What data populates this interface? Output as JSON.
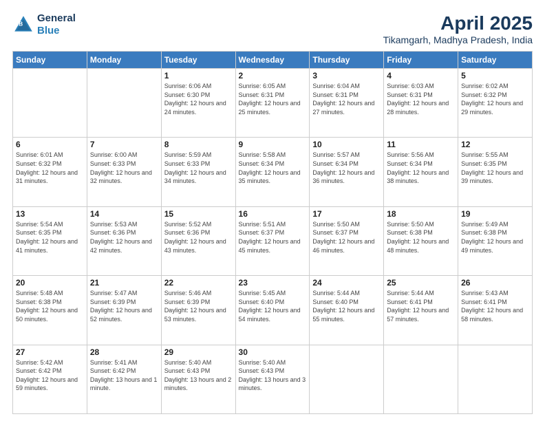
{
  "header": {
    "logo_line1": "General",
    "logo_line2": "Blue",
    "title": "April 2025",
    "subtitle": "Tikamgarh, Madhya Pradesh, India"
  },
  "days_of_week": [
    "Sunday",
    "Monday",
    "Tuesday",
    "Wednesday",
    "Thursday",
    "Friday",
    "Saturday"
  ],
  "weeks": [
    [
      {
        "day": "",
        "sunrise": "",
        "sunset": "",
        "daylight": ""
      },
      {
        "day": "",
        "sunrise": "",
        "sunset": "",
        "daylight": ""
      },
      {
        "day": "1",
        "sunrise": "Sunrise: 6:06 AM",
        "sunset": "Sunset: 6:30 PM",
        "daylight": "Daylight: 12 hours and 24 minutes."
      },
      {
        "day": "2",
        "sunrise": "Sunrise: 6:05 AM",
        "sunset": "Sunset: 6:31 PM",
        "daylight": "Daylight: 12 hours and 25 minutes."
      },
      {
        "day": "3",
        "sunrise": "Sunrise: 6:04 AM",
        "sunset": "Sunset: 6:31 PM",
        "daylight": "Daylight: 12 hours and 27 minutes."
      },
      {
        "day": "4",
        "sunrise": "Sunrise: 6:03 AM",
        "sunset": "Sunset: 6:31 PM",
        "daylight": "Daylight: 12 hours and 28 minutes."
      },
      {
        "day": "5",
        "sunrise": "Sunrise: 6:02 AM",
        "sunset": "Sunset: 6:32 PM",
        "daylight": "Daylight: 12 hours and 29 minutes."
      }
    ],
    [
      {
        "day": "6",
        "sunrise": "Sunrise: 6:01 AM",
        "sunset": "Sunset: 6:32 PM",
        "daylight": "Daylight: 12 hours and 31 minutes."
      },
      {
        "day": "7",
        "sunrise": "Sunrise: 6:00 AM",
        "sunset": "Sunset: 6:33 PM",
        "daylight": "Daylight: 12 hours and 32 minutes."
      },
      {
        "day": "8",
        "sunrise": "Sunrise: 5:59 AM",
        "sunset": "Sunset: 6:33 PM",
        "daylight": "Daylight: 12 hours and 34 minutes."
      },
      {
        "day": "9",
        "sunrise": "Sunrise: 5:58 AM",
        "sunset": "Sunset: 6:34 PM",
        "daylight": "Daylight: 12 hours and 35 minutes."
      },
      {
        "day": "10",
        "sunrise": "Sunrise: 5:57 AM",
        "sunset": "Sunset: 6:34 PM",
        "daylight": "Daylight: 12 hours and 36 minutes."
      },
      {
        "day": "11",
        "sunrise": "Sunrise: 5:56 AM",
        "sunset": "Sunset: 6:34 PM",
        "daylight": "Daylight: 12 hours and 38 minutes."
      },
      {
        "day": "12",
        "sunrise": "Sunrise: 5:55 AM",
        "sunset": "Sunset: 6:35 PM",
        "daylight": "Daylight: 12 hours and 39 minutes."
      }
    ],
    [
      {
        "day": "13",
        "sunrise": "Sunrise: 5:54 AM",
        "sunset": "Sunset: 6:35 PM",
        "daylight": "Daylight: 12 hours and 41 minutes."
      },
      {
        "day": "14",
        "sunrise": "Sunrise: 5:53 AM",
        "sunset": "Sunset: 6:36 PM",
        "daylight": "Daylight: 12 hours and 42 minutes."
      },
      {
        "day": "15",
        "sunrise": "Sunrise: 5:52 AM",
        "sunset": "Sunset: 6:36 PM",
        "daylight": "Daylight: 12 hours and 43 minutes."
      },
      {
        "day": "16",
        "sunrise": "Sunrise: 5:51 AM",
        "sunset": "Sunset: 6:37 PM",
        "daylight": "Daylight: 12 hours and 45 minutes."
      },
      {
        "day": "17",
        "sunrise": "Sunrise: 5:50 AM",
        "sunset": "Sunset: 6:37 PM",
        "daylight": "Daylight: 12 hours and 46 minutes."
      },
      {
        "day": "18",
        "sunrise": "Sunrise: 5:50 AM",
        "sunset": "Sunset: 6:38 PM",
        "daylight": "Daylight: 12 hours and 48 minutes."
      },
      {
        "day": "19",
        "sunrise": "Sunrise: 5:49 AM",
        "sunset": "Sunset: 6:38 PM",
        "daylight": "Daylight: 12 hours and 49 minutes."
      }
    ],
    [
      {
        "day": "20",
        "sunrise": "Sunrise: 5:48 AM",
        "sunset": "Sunset: 6:38 PM",
        "daylight": "Daylight: 12 hours and 50 minutes."
      },
      {
        "day": "21",
        "sunrise": "Sunrise: 5:47 AM",
        "sunset": "Sunset: 6:39 PM",
        "daylight": "Daylight: 12 hours and 52 minutes."
      },
      {
        "day": "22",
        "sunrise": "Sunrise: 5:46 AM",
        "sunset": "Sunset: 6:39 PM",
        "daylight": "Daylight: 12 hours and 53 minutes."
      },
      {
        "day": "23",
        "sunrise": "Sunrise: 5:45 AM",
        "sunset": "Sunset: 6:40 PM",
        "daylight": "Daylight: 12 hours and 54 minutes."
      },
      {
        "day": "24",
        "sunrise": "Sunrise: 5:44 AM",
        "sunset": "Sunset: 6:40 PM",
        "daylight": "Daylight: 12 hours and 55 minutes."
      },
      {
        "day": "25",
        "sunrise": "Sunrise: 5:44 AM",
        "sunset": "Sunset: 6:41 PM",
        "daylight": "Daylight: 12 hours and 57 minutes."
      },
      {
        "day": "26",
        "sunrise": "Sunrise: 5:43 AM",
        "sunset": "Sunset: 6:41 PM",
        "daylight": "Daylight: 12 hours and 58 minutes."
      }
    ],
    [
      {
        "day": "27",
        "sunrise": "Sunrise: 5:42 AM",
        "sunset": "Sunset: 6:42 PM",
        "daylight": "Daylight: 12 hours and 59 minutes."
      },
      {
        "day": "28",
        "sunrise": "Sunrise: 5:41 AM",
        "sunset": "Sunset: 6:42 PM",
        "daylight": "Daylight: 13 hours and 1 minute."
      },
      {
        "day": "29",
        "sunrise": "Sunrise: 5:40 AM",
        "sunset": "Sunset: 6:43 PM",
        "daylight": "Daylight: 13 hours and 2 minutes."
      },
      {
        "day": "30",
        "sunrise": "Sunrise: 5:40 AM",
        "sunset": "Sunset: 6:43 PM",
        "daylight": "Daylight: 13 hours and 3 minutes."
      },
      {
        "day": "",
        "sunrise": "",
        "sunset": "",
        "daylight": ""
      },
      {
        "day": "",
        "sunrise": "",
        "sunset": "",
        "daylight": ""
      },
      {
        "day": "",
        "sunrise": "",
        "sunset": "",
        "daylight": ""
      }
    ]
  ]
}
